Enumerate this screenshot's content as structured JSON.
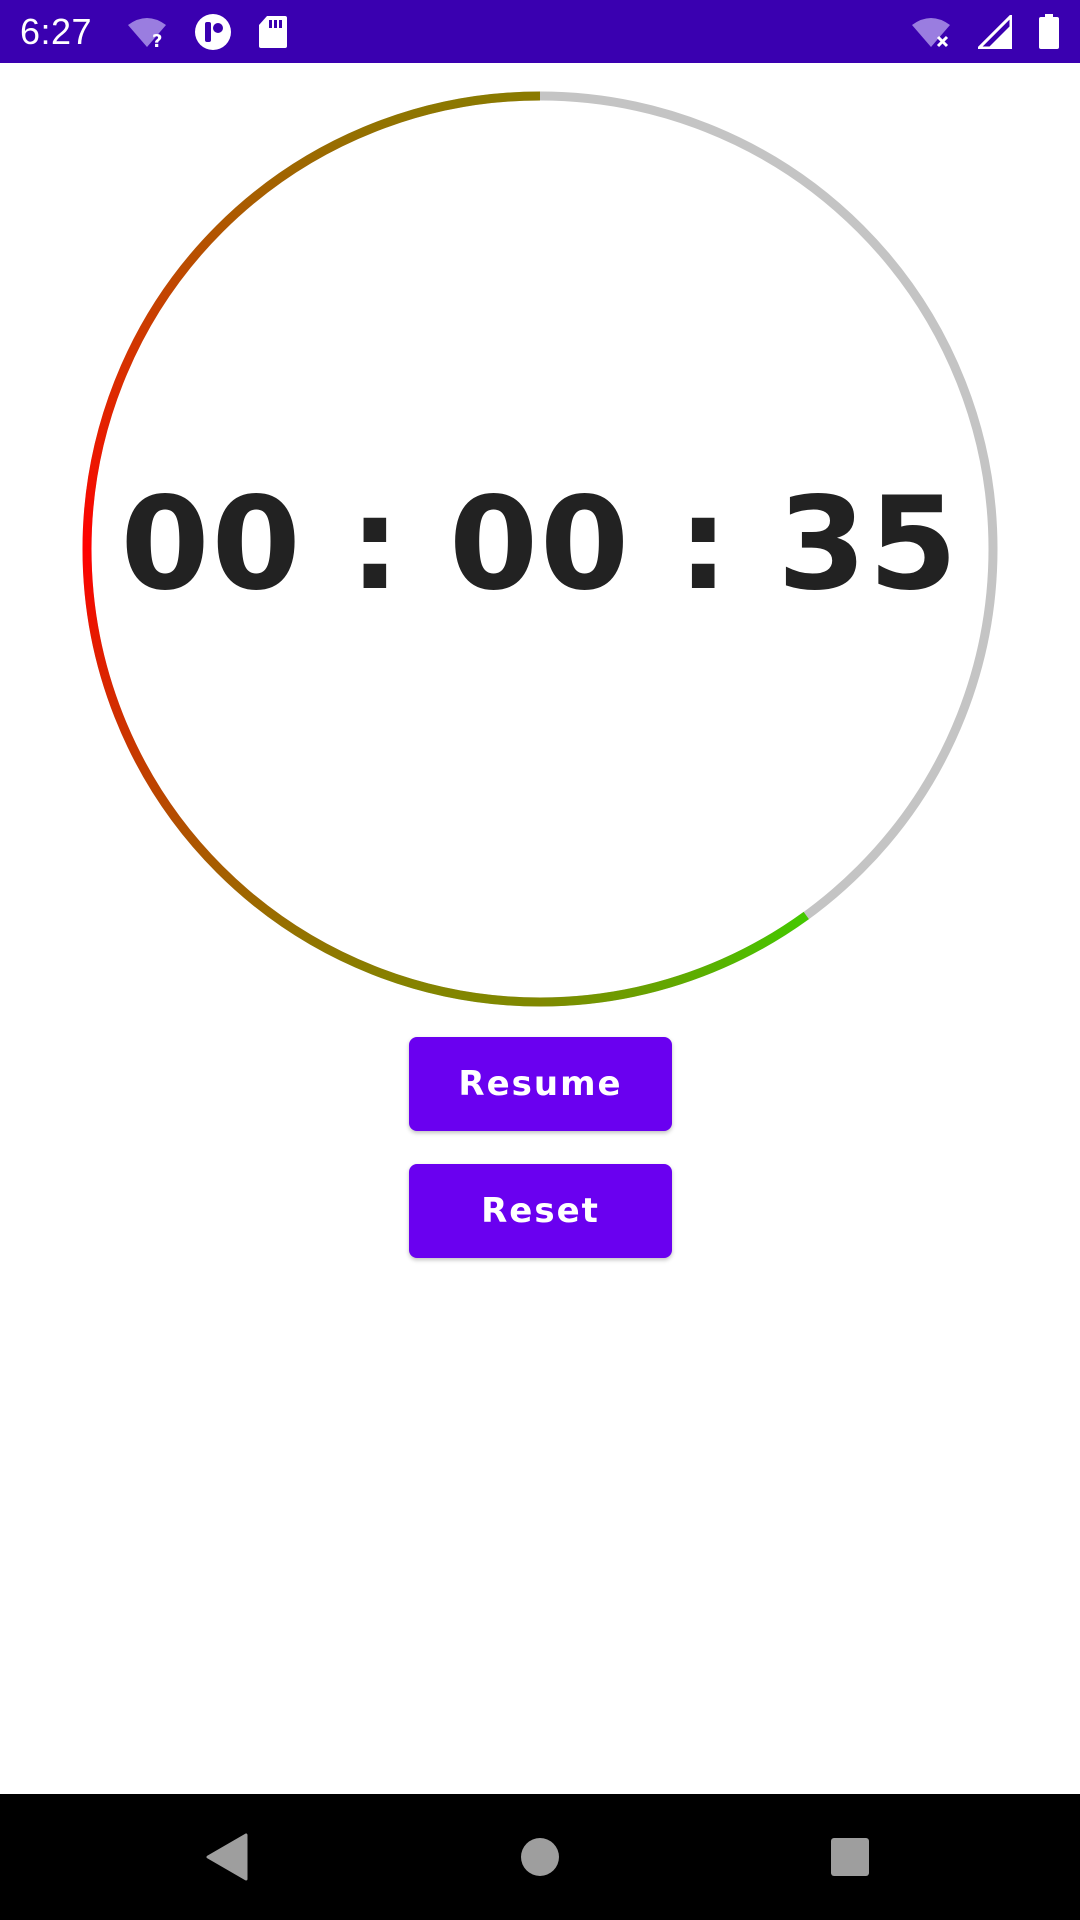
{
  "status_bar": {
    "time": "6:27",
    "background": "#3a00b0",
    "left_icons": [
      "wifi-unknown-icon",
      "app-notification-icon",
      "sd-card-icon"
    ],
    "right_icons": [
      "wifi-off-icon",
      "signal-icon",
      "battery-icon"
    ]
  },
  "timer": {
    "display": "00 : 00 : 35",
    "progress_fraction": 0.6,
    "track_color": "#c4c4c4",
    "gradient_colors": [
      "#44c800",
      "#8a8000",
      "#ff0000",
      "#8a8000"
    ]
  },
  "buttons": {
    "resume_label": "Resume",
    "reset_label": "Reset",
    "color": "#6a00f0"
  },
  "nav_bar": {
    "icons": [
      "back-icon",
      "home-icon",
      "recents-icon"
    ]
  }
}
